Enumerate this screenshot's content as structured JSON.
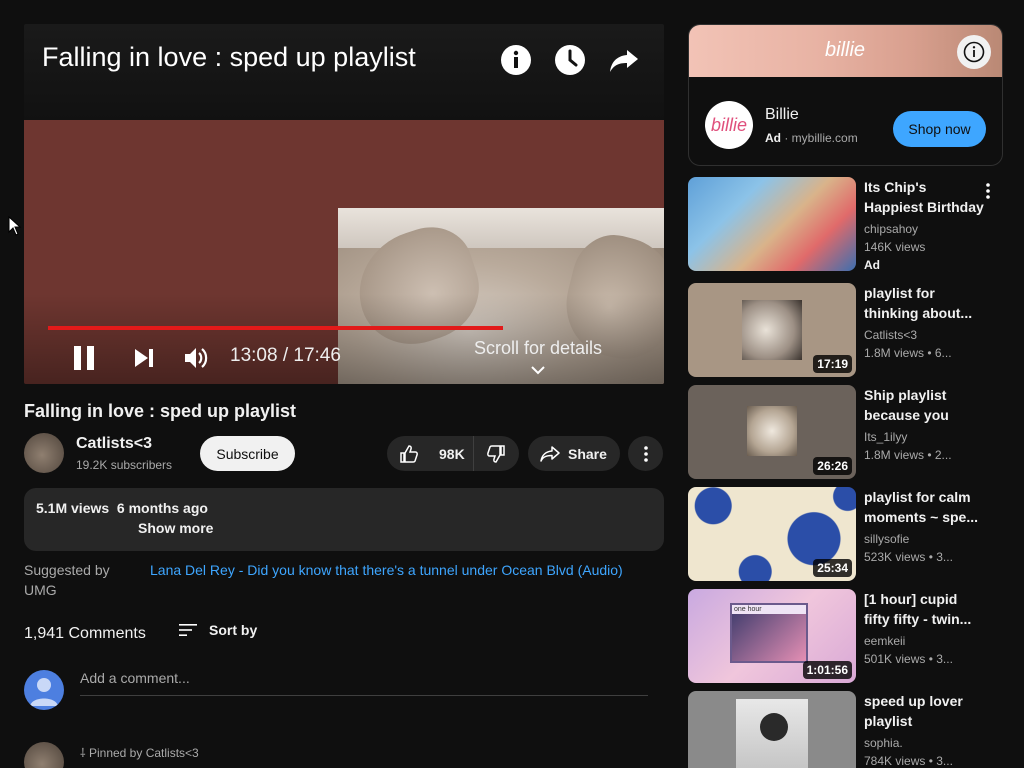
{
  "player": {
    "title": "Falling in love : sped up playlist",
    "time": "13:08 / 17:46",
    "scroll_hint": "Scroll for details",
    "progress": 0.739,
    "icons": [
      "info-icon",
      "watch-later-icon",
      "share-arrow-icon",
      "pause-icon",
      "next-icon",
      "volume-icon",
      "chevron-down-icon"
    ]
  },
  "video": {
    "title": "Falling in love : sped up playlist",
    "channel": "Catlists<3",
    "subscribers": "19.2K subscribers",
    "subscribe_label": "Subscribe",
    "likes": "98K",
    "share_label": "Share",
    "views_date": "5.1M views  6 months ago",
    "show_more": "Show more",
    "suggested_by": "Suggested by UMG",
    "suggested_link": "Lana Del Rey - Did you know that there's a tunnel under Ocean Blvd (Audio)"
  },
  "comments": {
    "count": "1,941 Comments",
    "sort_label": "Sort by",
    "placeholder": "Add a comment...",
    "pinned": "Pinned by Catlists<3"
  },
  "ad": {
    "brand": "billie",
    "name": "Billie",
    "label": "Ad",
    "domain": "mybillie.com",
    "cta": "Shop now"
  },
  "recommendations": [
    {
      "title": "Its Chip's Happiest Birthday",
      "channel": "chipsahoy",
      "stats": "146K views",
      "ad": "Ad",
      "duration": ""
    },
    {
      "title": "playlist for thinking about...",
      "channel": "Catlists<3",
      "stats": "1.8M views  • 6...",
      "duration": "17:19"
    },
    {
      "title": "Ship playlist because you are...",
      "channel": "Its_1ilyy",
      "stats": "1.8M views  • 2...",
      "duration": "26:26"
    },
    {
      "title": "playlist for calm moments ~ spe...",
      "channel": "sillysofie",
      "stats": "523K views  • 3...",
      "duration": "25:34"
    },
    {
      "title": "[1 hour] cupid fifty fifty - twin...",
      "channel": "eemkeii",
      "stats": "501K views  • 3...",
      "duration": "1:01:56",
      "thumb_text": "one hour"
    },
    {
      "title": "speed up lover playlist",
      "channel": "sophia.",
      "stats": "784K views  • 3...",
      "duration": ""
    }
  ],
  "colors": {
    "background": "#0f0f0f",
    "progress": "#e21a1a",
    "link": "#3ea6ff",
    "cta": "#3ea6ff"
  }
}
